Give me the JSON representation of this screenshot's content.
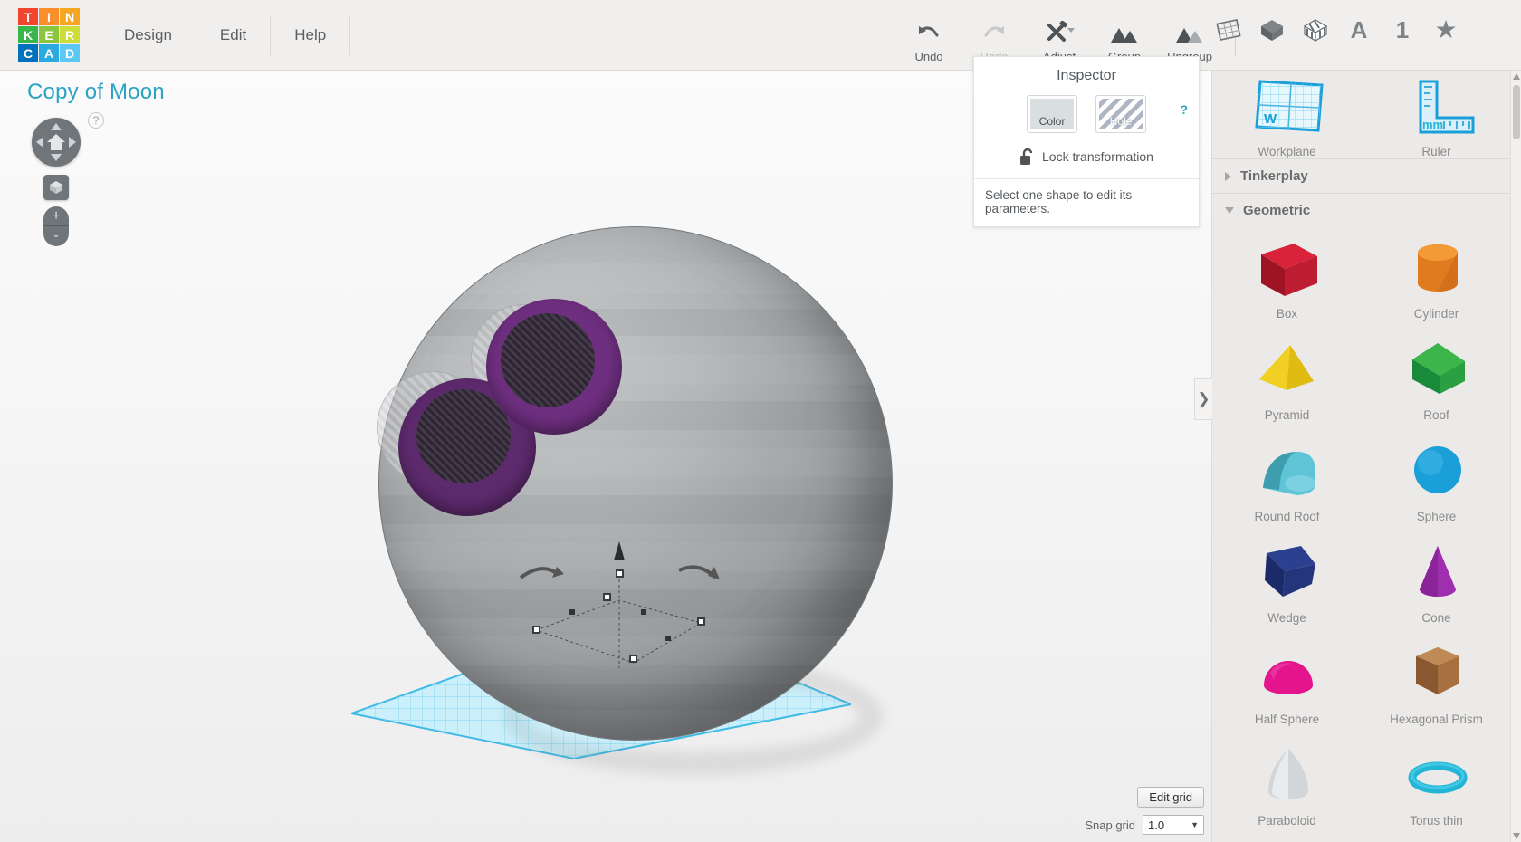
{
  "app": {
    "name": "Tinkercad",
    "logo_letters": [
      "T",
      "I",
      "N",
      "K",
      "E",
      "R",
      "C",
      "A",
      "D"
    ]
  },
  "menu": {
    "items": [
      {
        "label": "Design",
        "name": "menu-design"
      },
      {
        "label": "Edit",
        "name": "menu-edit"
      },
      {
        "label": "Help",
        "name": "menu-help"
      }
    ]
  },
  "toolbar": {
    "undo": "Undo",
    "redo": "Redo",
    "adjust": "Adjust",
    "group": "Group",
    "ungroup": "Ungroup",
    "right_icons": [
      "grid-icon",
      "solid-cube-icon",
      "striped-cube-icon",
      "text-A-icon",
      "number-1-icon",
      "star-icon"
    ],
    "right_icon_letters": {
      "text": "A",
      "number": "1",
      "star": "★"
    }
  },
  "canvas": {
    "design_title": "Copy of Moon",
    "help_badge": "?",
    "nav_home_icon": "home-icon",
    "zoom_in": "+",
    "zoom_out": "-"
  },
  "inspector": {
    "title": "Inspector",
    "help_link": "?",
    "color_label": "Color",
    "hole_label": "Hole",
    "lock_label": "Lock transformation",
    "hint": "Select one shape to edit its parameters.",
    "color_swatch_hex": "#d9dfe1"
  },
  "shape_panel": {
    "top_tools": [
      {
        "label": "Workplane",
        "icon": "workplane-icon",
        "badge": "W"
      },
      {
        "label": "Ruler",
        "icon": "ruler-icon",
        "badge": "mm"
      }
    ],
    "sections": [
      {
        "label": "Tinkerplay",
        "expanded": false
      },
      {
        "label": "Geometric",
        "expanded": true
      }
    ],
    "shapes": [
      {
        "label": "Box",
        "color": "#c0192b"
      },
      {
        "label": "Cylinder",
        "color": "#e07b1f"
      },
      {
        "label": "Pyramid",
        "color": "#e8c51b"
      },
      {
        "label": "Roof",
        "color": "#1f9c3c"
      },
      {
        "label": "Round Roof",
        "color": "#58bcd0"
      },
      {
        "label": "Sphere",
        "color": "#1a9fd9"
      },
      {
        "label": "Wedge",
        "color": "#25357a"
      },
      {
        "label": "Cone",
        "color": "#9c2fa8"
      },
      {
        "label": "Half Sphere",
        "color": "#e3148c"
      },
      {
        "label": "Hexagonal Prism",
        "color": "#9a5f36"
      },
      {
        "label": "Paraboloid",
        "color": "#c8cbcd"
      },
      {
        "label": "Torus thin",
        "color": "#22b5d6"
      }
    ],
    "collapse_chevron": "❯"
  },
  "grid_controls": {
    "edit_grid": "Edit grid",
    "snap_grid_label": "Snap grid",
    "snap_grid_value": "1.0",
    "snap_caret": "▼"
  }
}
